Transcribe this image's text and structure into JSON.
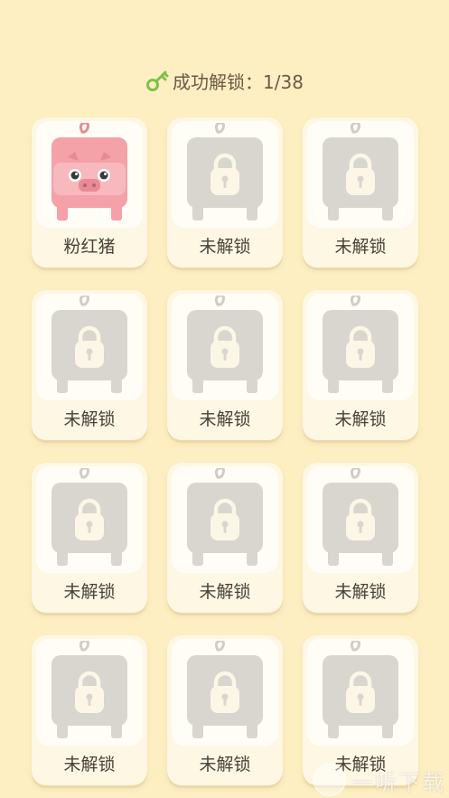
{
  "header": {
    "text": "成功解锁：1/38",
    "key_icon": "key-icon",
    "key_color": "#7cc24a"
  },
  "cards": [
    {
      "label": "粉红猪",
      "locked": false,
      "icon": "pink-pig-icon"
    },
    {
      "label": "未解锁",
      "locked": true,
      "icon": "locked-pig-icon"
    },
    {
      "label": "未解锁",
      "locked": true,
      "icon": "locked-pig-icon"
    },
    {
      "label": "未解锁",
      "locked": true,
      "icon": "locked-pig-icon"
    },
    {
      "label": "未解锁",
      "locked": true,
      "icon": "locked-pig-icon"
    },
    {
      "label": "未解锁",
      "locked": true,
      "icon": "locked-pig-icon"
    },
    {
      "label": "未解锁",
      "locked": true,
      "icon": "locked-pig-icon"
    },
    {
      "label": "未解锁",
      "locked": true,
      "icon": "locked-pig-icon"
    },
    {
      "label": "未解锁",
      "locked": true,
      "icon": "locked-pig-icon"
    },
    {
      "label": "未解锁",
      "locked": true,
      "icon": "locked-pig-icon"
    },
    {
      "label": "未解锁",
      "locked": true,
      "icon": "locked-pig-icon"
    },
    {
      "label": "未解锁",
      "locked": true,
      "icon": "locked-pig-icon"
    }
  ],
  "watermark": {
    "text": "一听下载"
  },
  "colors": {
    "background": "#fdefc2",
    "card": "#fef7e4",
    "locked_gray": "#d8d6cf",
    "pig_pink": "#f4a1a8"
  }
}
